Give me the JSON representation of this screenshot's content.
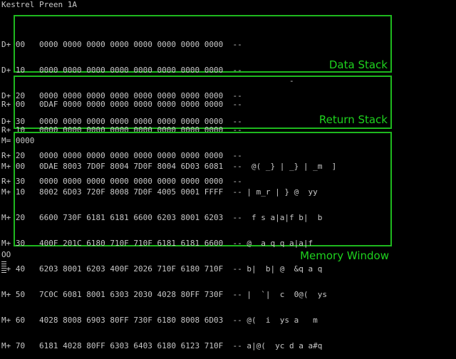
{
  "title": "Kestrel Preen 1A",
  "panels": {
    "data": {
      "label": "Data Stack"
    },
    "return": {
      "label": "Return Stack"
    },
    "memory": {
      "label": "Memory Window"
    }
  },
  "data_stack": [
    "D+ 00   0000 0000 0000 0000 0000 0000 0000 0000  --",
    "D+ 10   0000 0000 0000 0000 0000 0000 0000 0000  --",
    "D+ 20   0000 0000 0000 0000 0000 0000 0000 0000  --",
    "D+ 30   0000 0000 0000 0000 0000 0000 0000 0000  --"
  ],
  "return_stack": [
    "R+ 00   0DAF 0000 0000 0000 0000 0000 0000 0000  --",
    "R+ 10   0000 0000 0000 0000 0000 0000 0000 0000  --",
    "R+ 20   0000 0000 0000 0000 0000 0000 0000 0000  --",
    "R+ 30   0000 0000 0000 0000 0000 0000 0000 0000  --"
  ],
  "return_marker": "-",
  "memory": {
    "address": "M= 0000",
    "rows": [
      "M+ 00   0DAE 8003 7D0F 8004 7D0F 8004 6D03 6081  --  @( _} | _} | _m  ]",
      "M+ 10   8002 6D03 720F 8008 7D0F 4005 0001 FFFF  -- | m_r | } @  yy",
      "M+ 20   6600 730F 6181 6181 6600 6203 8001 6203  --  f s a|a|f b|  b",
      "M+ 30   400F 201C 6180 710F 710F 6181 6181 6600  -- @  a q q a|a|f",
      "M+ 40   6203 8001 6203 400F 2026 710F 6180 710F  -- b|  b| @  &q a q",
      "M+ 50   7C0C 6081 8001 6303 2030 4028 80FF 730F  -- |  `|  c  0@(  ys",
      "M+ 60   4028 8008 6903 80FF 730F 6180 8008 6D03  -- @(  i  ys a   m",
      "M+ 70   6181 4028 80FF 6303 6403 6180 6123 710F  -- a|@(  yc d a a#q"
    ]
  },
  "prompt": "OO"
}
